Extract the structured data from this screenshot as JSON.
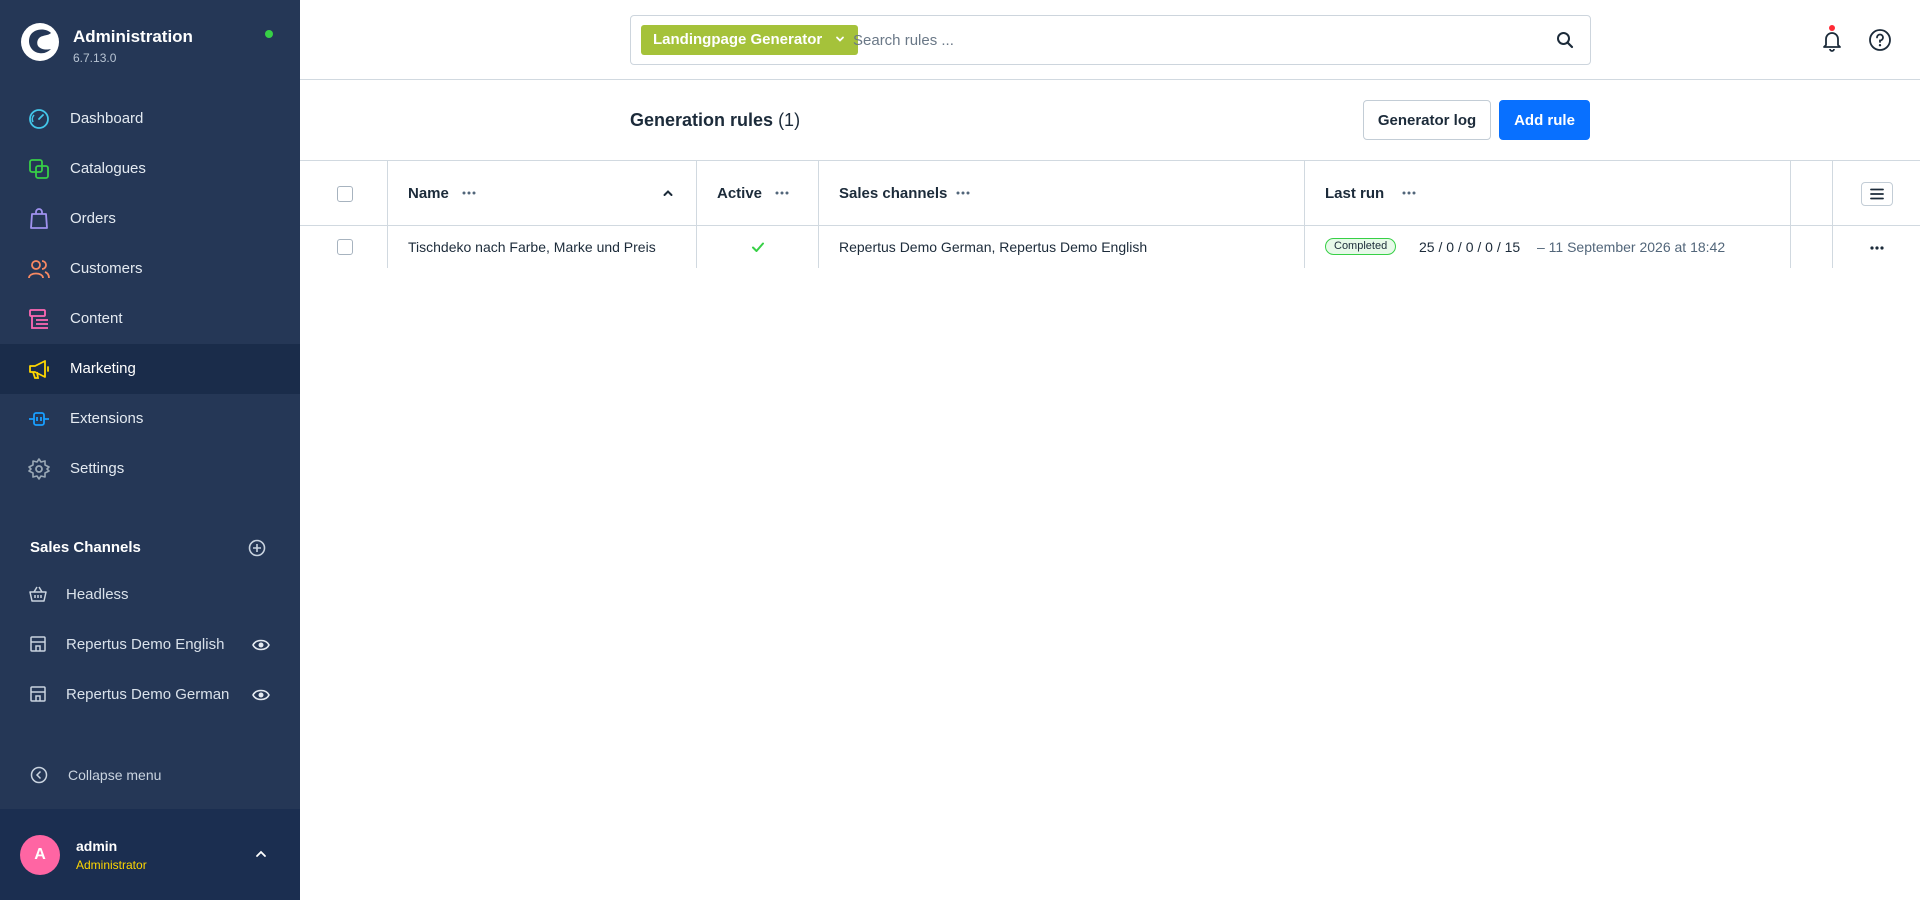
{
  "app": {
    "title": "Administration",
    "version": "6.7.13.0",
    "status_color": "#37d046"
  },
  "sidebar": {
    "items": [
      {
        "label": "Dashboard",
        "icon": "dashboard-icon",
        "color": "#43c6e9"
      },
      {
        "label": "Catalogues",
        "icon": "catalogue-icon",
        "color": "#37d046"
      },
      {
        "label": "Orders",
        "icon": "shopping-bag-icon",
        "color": "#a092f0"
      },
      {
        "label": "Customers",
        "icon": "users-icon",
        "color": "#f88962"
      },
      {
        "label": "Content",
        "icon": "content-icon",
        "color": "#ff68b4"
      },
      {
        "label": "Marketing",
        "icon": "megaphone-icon",
        "color": "#ffd700",
        "active": true
      },
      {
        "label": "Extensions",
        "icon": "plug-icon",
        "color": "#189eff"
      },
      {
        "label": "Settings",
        "icon": "gear-icon",
        "color": "#9aa8b5"
      }
    ],
    "sales_channels": {
      "title": "Sales Channels",
      "items": [
        {
          "label": "Headless",
          "icon": "basket-icon"
        },
        {
          "label": "Repertus Demo English",
          "icon": "storefront-icon"
        },
        {
          "label": "Repertus Demo German",
          "icon": "storefront-icon"
        }
      ]
    },
    "collapse_label": "Collapse menu",
    "user": {
      "initial": "A",
      "name": "admin",
      "role": "Administrator"
    }
  },
  "search": {
    "type_label": "Landingpage Generator",
    "type_color": "#a5c23a",
    "placeholder": "Search rules ..."
  },
  "header": {
    "title": "Generation rules",
    "count": "(1)",
    "log_button": "Generator log",
    "add_button": "Add rule",
    "accent_color": "#0870ff"
  },
  "table": {
    "columns": {
      "name": "Name",
      "active": "Active",
      "sales_channels": "Sales channels",
      "last_run": "Last run"
    },
    "rows": [
      {
        "name": "Tischdeko nach Farbe, Marke und Preis",
        "active": true,
        "sales_channels": "Repertus Demo German, Repertus Demo English",
        "status": "Completed",
        "stats": "25 / 0 / 0 / 0 / 15",
        "run_date": "– 11 September 2026 at 18:42"
      }
    ]
  }
}
